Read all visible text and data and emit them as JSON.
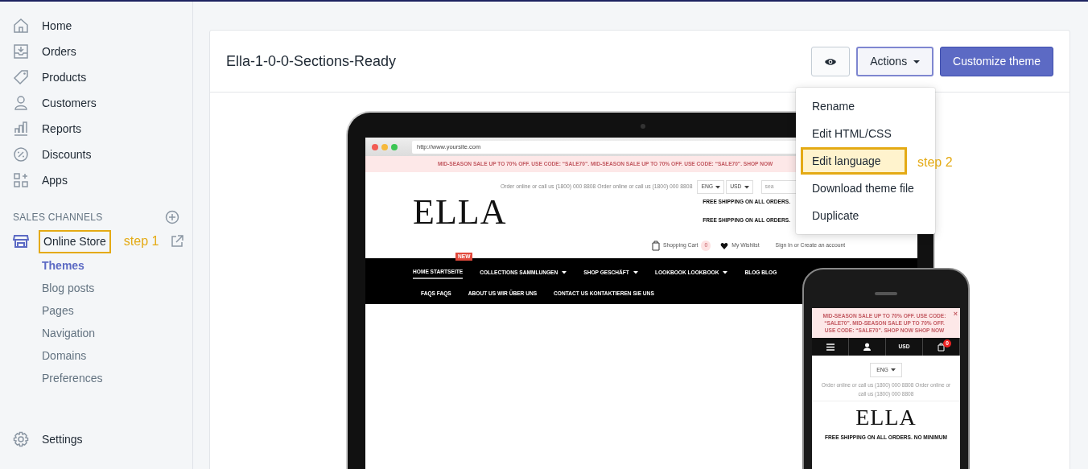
{
  "sidebar": {
    "items": [
      {
        "label": "Home"
      },
      {
        "label": "Orders"
      },
      {
        "label": "Products"
      },
      {
        "label": "Customers"
      },
      {
        "label": "Reports"
      },
      {
        "label": "Discounts"
      },
      {
        "label": "Apps"
      }
    ],
    "section_title": "SALES CHANNELS",
    "channel": {
      "label": "Online Store",
      "highlighted": true,
      "annotation": "step 1",
      "sub_items": [
        {
          "label": "Themes",
          "selected": true
        },
        {
          "label": "Blog posts",
          "selected": false
        },
        {
          "label": "Pages",
          "selected": false
        },
        {
          "label": "Navigation",
          "selected": false
        },
        {
          "label": "Domains",
          "selected": false
        },
        {
          "label": "Preferences",
          "selected": false
        }
      ]
    },
    "settings": "Settings"
  },
  "theme": {
    "title": "Ella-1-0-0-Sections-Ready",
    "actions_label": "Actions",
    "actions_expanded": true,
    "customize_label": "Customize theme"
  },
  "actions_menu": {
    "items": [
      {
        "label": "Rename",
        "highlighted": false
      },
      {
        "label": "Edit HTML/CSS",
        "highlighted": false
      },
      {
        "label": "Edit language",
        "highlighted": true
      },
      {
        "label": "Download theme file",
        "highlighted": false
      },
      {
        "label": "Duplicate",
        "highlighted": false
      }
    ],
    "annotation": "step 2"
  },
  "laptop_preview": {
    "url": "http://www.yoursite.com",
    "banner": "MID-SEASON SALE UP TO 70% OFF. USE CODE: “SALE70”. MID-SEASON SALE UP TO 70% OFF. USE CODE: “SALE70”.",
    "banner_link": "SHOP NOW",
    "contact": "Order online or call us (1800) 000 8808 Order online or call us (1800) 000 8808",
    "language": "ENG",
    "currency": "USD",
    "search_placeholder": "sea",
    "logo": "ELLA",
    "shipping": [
      "FREE SHIPPING ON ALL ORDERS.",
      "FREE SHIPPING ON ALL ORDERS."
    ],
    "cart_label": "Shopping Cart",
    "cart_count": "0",
    "wishlist_label": "My Wishlist",
    "account_label": "Sign In or Create an account",
    "nav_rows": [
      [
        {
          "label": "HOME STARTSEITE",
          "selected": true,
          "dropdown": false
        },
        {
          "label": "COLLECTIONS SAMMLUNGEN",
          "selected": false,
          "dropdown": true,
          "badge": "NEW"
        },
        {
          "label": "SHOP GESCHÄFT",
          "selected": false,
          "dropdown": true
        },
        {
          "label": "LOOKBOOK LOOKBOOK",
          "selected": false,
          "dropdown": true
        },
        {
          "label": "BLOG BLOG",
          "selected": false,
          "dropdown": false
        }
      ],
      [
        {
          "label": "FAQS FAQS",
          "selected": false,
          "dropdown": false
        },
        {
          "label": "ABOUT US WIR ÜBER UNS",
          "selected": false,
          "dropdown": false
        },
        {
          "label": "CONTACT US KONTAKTIEREN SIE UNS",
          "selected": false,
          "dropdown": false
        }
      ]
    ]
  },
  "phone_preview": {
    "banner": "MID-SEASON SALE UP TO 70% OFF. USE CODE: “SALE70”. MID-SEASON SALE UP TO 70% OFF. USE CODE: “SALE70”.",
    "banner_links": [
      "SHOP NOW",
      "SHOP NOW"
    ],
    "close": "×",
    "currency": "USD",
    "cart_count": "0",
    "language": "ENG",
    "contact": "Order online or call us (1800) 000 8808 Order online or call us (1800) 000 8808",
    "logo": "ELLA",
    "shipping": "FREE SHIPPING ON ALL ORDERS. NO MINIMUM"
  }
}
